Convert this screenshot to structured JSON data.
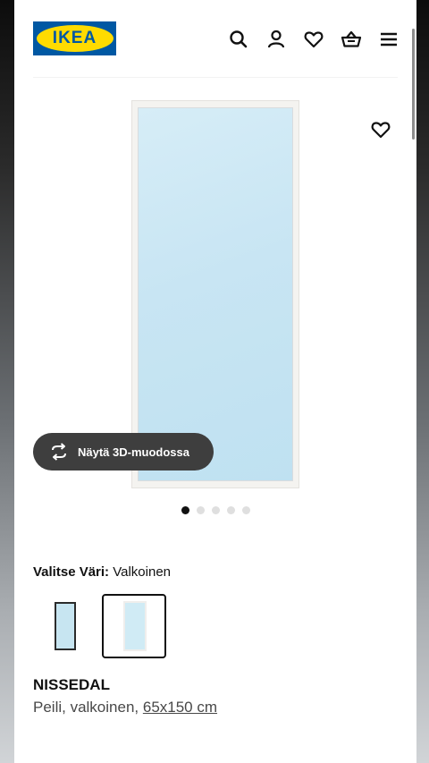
{
  "header": {
    "logo_text": "IKEA",
    "icons": [
      "search-icon",
      "account-icon",
      "heart-icon",
      "basket-icon",
      "menu-icon"
    ]
  },
  "gallery": {
    "favorite_icon": "heart-icon",
    "view_3d_label": "Näytä 3D-muodossa",
    "slide_count": 5,
    "active_slide": 1
  },
  "color": {
    "label": "Valitse Väri:",
    "value": "Valkoinen",
    "selected_option": 2
  },
  "product": {
    "name": "NISSEDAL",
    "description": "Peili, valkoinen,",
    "dimensions": "65x150 cm"
  },
  "colors": {
    "brand_blue": "#0058a3",
    "brand_yellow": "#ffdb00",
    "button_dark": "#3e3e3e"
  }
}
